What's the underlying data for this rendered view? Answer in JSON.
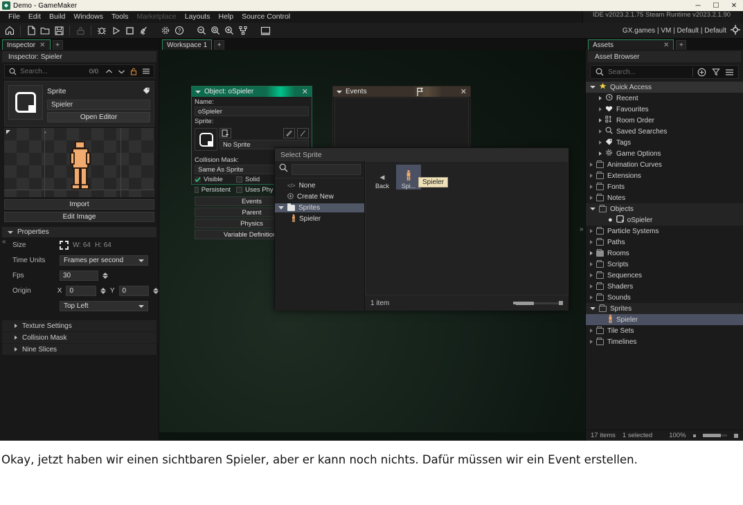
{
  "window": {
    "title": "Demo - GameMaker",
    "app_icon": "gamemaker-logo-icon",
    "controls": {
      "minimize": "─",
      "maximize": "☐",
      "close": "✕"
    }
  },
  "menubar": {
    "items": [
      {
        "label": "File",
        "enabled": true
      },
      {
        "label": "Edit",
        "enabled": true
      },
      {
        "label": "Build",
        "enabled": true
      },
      {
        "label": "Windows",
        "enabled": true
      },
      {
        "label": "Tools",
        "enabled": true
      },
      {
        "label": "Marketplace",
        "enabled": false
      },
      {
        "label": "Layouts",
        "enabled": true
      },
      {
        "label": "Help",
        "enabled": true
      },
      {
        "label": "Source Control",
        "enabled": true
      }
    ],
    "status": "IDE v2023.2.1.75 Steam  Runtime v2023.2.1.90"
  },
  "toolbar": {
    "buttons": [
      "home-icon",
      "new-file-icon",
      "open-folder-icon",
      "save-icon",
      "clean-icon",
      "debug-icon",
      "run-icon",
      "stop-icon",
      "broom-icon",
      "preferences-gear-icon",
      "help-question-icon",
      "zoom-out-icon",
      "zoom-reset-icon",
      "zoom-in-icon",
      "fit-to-window-icon",
      "display-icon"
    ],
    "target": "GX.games | VM | Default | Default",
    "target_icon": "target-crosshair-icon"
  },
  "inspector": {
    "tab_label": "Inspector",
    "tab_close": "✕",
    "tab_add": "+",
    "header": "Inspector: Spieler",
    "search": {
      "placeholder": "Search...",
      "count": "0/0"
    },
    "sprite_card": {
      "title": "Sprite",
      "name_value": "Spieler",
      "open_editor": "Open Editor",
      "tag_icon": "tag-icon"
    },
    "buttons": {
      "import": "Import",
      "edit_image": "Edit Image"
    },
    "properties": {
      "section_label": "Properties",
      "size_label": "Size",
      "size_w": "W: 64",
      "size_h": "H: 64",
      "time_units_label": "Time Units",
      "time_units_value": "Frames per second",
      "fps_label": "Fps",
      "fps_value": "30",
      "origin_label": "Origin",
      "origin_x_label": "X",
      "origin_x_value": "0",
      "origin_y_label": "Y",
      "origin_y_value": "0",
      "origin_preset": "Top Left"
    },
    "collapsed_sections": [
      "Texture Settings",
      "Collision Mask",
      "Nine Slices"
    ]
  },
  "workspace": {
    "tab_label": "Workspace 1",
    "tab_add": "+",
    "collapse_chevron": "⌃"
  },
  "object_window": {
    "title": "Object: oSpieler",
    "close": "✕",
    "name_label": "Name:",
    "name_value": "oSpieler",
    "sprite_label": "Sprite:",
    "sprite_value": "No Sprite",
    "collision_label": "Collision Mask:",
    "collision_value": "Same As Sprite",
    "checkboxes": [
      {
        "label": "Visible",
        "checked": true
      },
      {
        "label": "Solid",
        "checked": false
      },
      {
        "label": "Persistent",
        "checked": false
      },
      {
        "label": "Uses Phy",
        "checked": false
      }
    ],
    "buttons": [
      "Events",
      "Parent",
      "Physics",
      "Variable Definitions"
    ]
  },
  "events_window": {
    "title": "Events",
    "close": "✕",
    "flag_icon": "flag-icon"
  },
  "select_sprite_dialog": {
    "title": "Select Sprite",
    "search_value": "",
    "tree": [
      {
        "label": "None",
        "icon": "code-brackets-icon",
        "selected": false,
        "indent": 1
      },
      {
        "label": "Create New",
        "icon": "plus-circle-icon",
        "selected": false,
        "indent": 1
      },
      {
        "label": "Sprites",
        "icon": "folder-icon",
        "selected": true,
        "indent": 0
      },
      {
        "label": "Spieler",
        "icon": "sprite-person-icon",
        "selected": false,
        "indent": 2
      }
    ],
    "grid": [
      {
        "label": "Back",
        "icon": "back-arrow-icon",
        "selected": false
      },
      {
        "label": "Spi...",
        "icon": "sprite-person-icon",
        "selected": true
      }
    ],
    "tooltip": "Spieler",
    "status": "1 item"
  },
  "assets": {
    "tab_label": "Assets",
    "tab_close": "✕",
    "tab_add": "+",
    "header": "Asset Browser",
    "search_placeholder": "Search...",
    "toolbar_icons": [
      "add-circle-icon",
      "filter-funnel-icon",
      "hamburger-menu-icon"
    ],
    "quick_access": {
      "label": "Quick Access",
      "icon": "star-icon",
      "items": [
        {
          "label": "Recent",
          "icon": "clock-history-icon",
          "expandable": true
        },
        {
          "label": "Favourites",
          "icon": "heart-icon",
          "expandable": false
        },
        {
          "label": "Room Order",
          "icon": "room-order-icon",
          "expandable": true
        },
        {
          "label": "Saved Searches",
          "icon": "search-icon",
          "expandable": false
        },
        {
          "label": "Tags",
          "icon": "tag-icon",
          "expandable": false
        },
        {
          "label": "Game Options",
          "icon": "gear-icon",
          "expandable": true
        }
      ]
    },
    "groups": [
      {
        "label": "Animation Curves",
        "expanded": false,
        "children": []
      },
      {
        "label": "Extensions",
        "expanded": false,
        "children": []
      },
      {
        "label": "Fonts",
        "expanded": false,
        "children": []
      },
      {
        "label": "Notes",
        "expanded": false,
        "children": []
      },
      {
        "label": "Objects",
        "expanded": true,
        "children": [
          {
            "label": "oSpieler",
            "icon": "object-icon",
            "selected": false
          }
        ]
      },
      {
        "label": "Particle Systems",
        "expanded": false,
        "children": []
      },
      {
        "label": "Paths",
        "expanded": false,
        "children": []
      },
      {
        "label": "Rooms",
        "expanded": false,
        "children": []
      },
      {
        "label": "Scripts",
        "expanded": false,
        "children": []
      },
      {
        "label": "Sequences",
        "expanded": false,
        "children": []
      },
      {
        "label": "Shaders",
        "expanded": false,
        "children": []
      },
      {
        "label": "Sounds",
        "expanded": false,
        "children": []
      },
      {
        "label": "Sprites",
        "expanded": true,
        "children": [
          {
            "label": "Spieler",
            "icon": "sprite-person-icon",
            "selected": true
          }
        ]
      },
      {
        "label": "Tile Sets",
        "expanded": false,
        "children": []
      },
      {
        "label": "Timelines",
        "expanded": false,
        "children": []
      }
    ],
    "status": {
      "items": "17 items",
      "selected": "1 selected",
      "zoom": "100%"
    }
  },
  "caption": {
    "text": "Okay, jetzt haben wir einen sichtbaren Spieler, aber er kann noch nichts. Dafür müssen wir ein Event erstellen."
  },
  "colors": {
    "accent_green": "#0f6b4d",
    "selection_blue": "#4b5162",
    "sprite_orange": "#f2ab6e",
    "tooltip_bg": "#efe2b8"
  }
}
